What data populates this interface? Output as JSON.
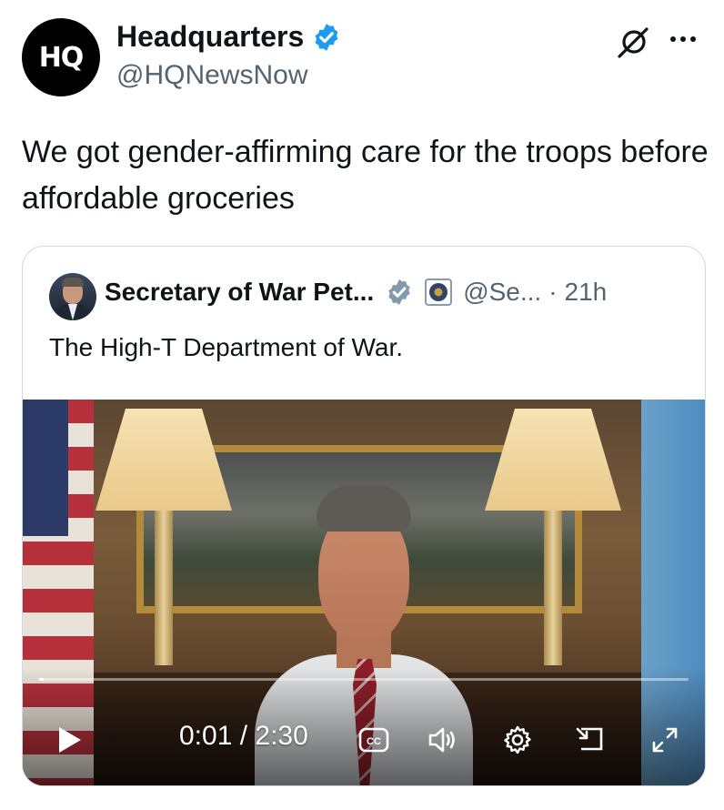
{
  "tweet": {
    "avatar_text": "HQ",
    "display_name": "Headquarters",
    "handle": "@HQNewsNow",
    "text": "We got gender-affirming care for the troops before affordable groceries"
  },
  "quote": {
    "display_name": "Secretary of War Pet...",
    "handle": "@Se...",
    "separator": "·",
    "time_ago": "21h",
    "text": "The High-T Department of War."
  },
  "video": {
    "time_display": "0:01 / 2:30",
    "progress_fraction": 0.007,
    "cc_label": "CC"
  },
  "icons": {
    "verified": "verified-badge-icon",
    "grok": "grok-icon",
    "more": "more-icon",
    "affiliate": "dod-seal-icon",
    "play": "play-icon",
    "cc": "cc-icon",
    "volume": "volume-icon",
    "settings": "gear-icon",
    "pip": "picture-in-picture-icon",
    "fullscreen": "fullscreen-icon"
  },
  "colors": {
    "verified_blue": "#1d9bf0",
    "secondary_text": "#536471",
    "border": "#cfd9de"
  }
}
